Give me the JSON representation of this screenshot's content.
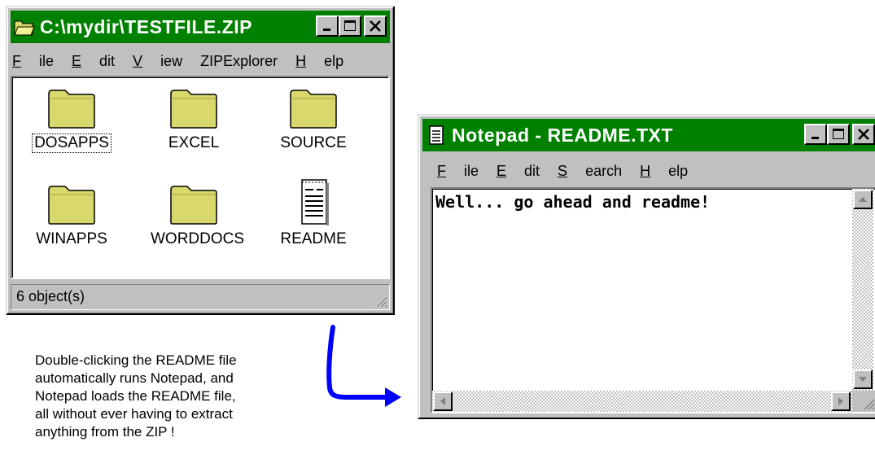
{
  "zip_window": {
    "title": "C:\\mydir\\TESTFILE.ZIP",
    "menu": [
      {
        "underline": "F",
        "rest": "ile"
      },
      {
        "underline": "E",
        "rest": "dit"
      },
      {
        "underline": "V",
        "rest": "iew"
      },
      {
        "underline": "",
        "rest": "ZIPExplorer"
      },
      {
        "underline": "H",
        "rest": "elp"
      }
    ],
    "items": [
      {
        "label": "DOSAPPS",
        "icon": "folder-icon"
      },
      {
        "label": "EXCEL",
        "icon": "folder-icon"
      },
      {
        "label": "SOURCE",
        "icon": "folder-icon"
      },
      {
        "label": "WINAPPS",
        "icon": "folder-icon"
      },
      {
        "label": "WORDDOCS",
        "icon": "folder-icon"
      },
      {
        "label": "README",
        "icon": "text-document-icon"
      }
    ],
    "status": "6 object(s)"
  },
  "notepad_window": {
    "title": "Notepad - README.TXT",
    "menu": [
      {
        "underline": "F",
        "rest": "ile"
      },
      {
        "underline": "E",
        "rest": "dit"
      },
      {
        "underline": "S",
        "rest": "earch"
      },
      {
        "underline": "H",
        "rest": "elp"
      }
    ],
    "content": "Well... go ahead and readme!"
  },
  "caption": [
    "Double-clicking the README file",
    "automatically runs Notepad, and",
    "Notepad loads the README file,",
    "all without ever having to extract",
    "anything from the ZIP !"
  ],
  "colors": {
    "title_bar": "#008000",
    "window_face": "#c0c0c0",
    "folder_fill": "#d8d86c",
    "arrow": "#0000ff"
  }
}
